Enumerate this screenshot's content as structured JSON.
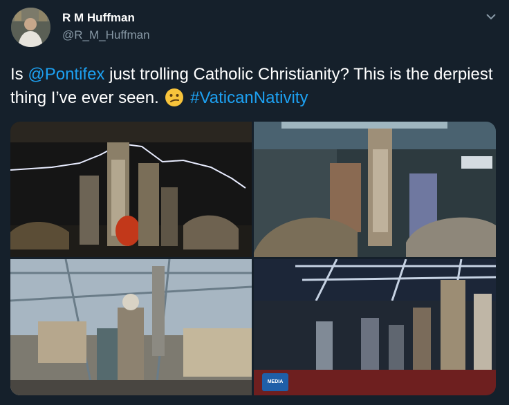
{
  "tweet": {
    "author_name": "R M Huffman",
    "handle": "@R_M_Huffman",
    "text_part1": "Is ",
    "mention": "@Pontifex",
    "text_part2": " just trolling Catholic Christianity? This is the derpiest thing I’ve ever seen. ",
    "hashtag": "#VaticanNativity",
    "emoji_name": "confused-face-icon",
    "menu_icon": "chevron-down-icon"
  },
  "media": {
    "badge_text": "MEDIA"
  },
  "colors": {
    "background": "#15202b",
    "link": "#1da1f2",
    "secondary_text": "#8899a6"
  }
}
